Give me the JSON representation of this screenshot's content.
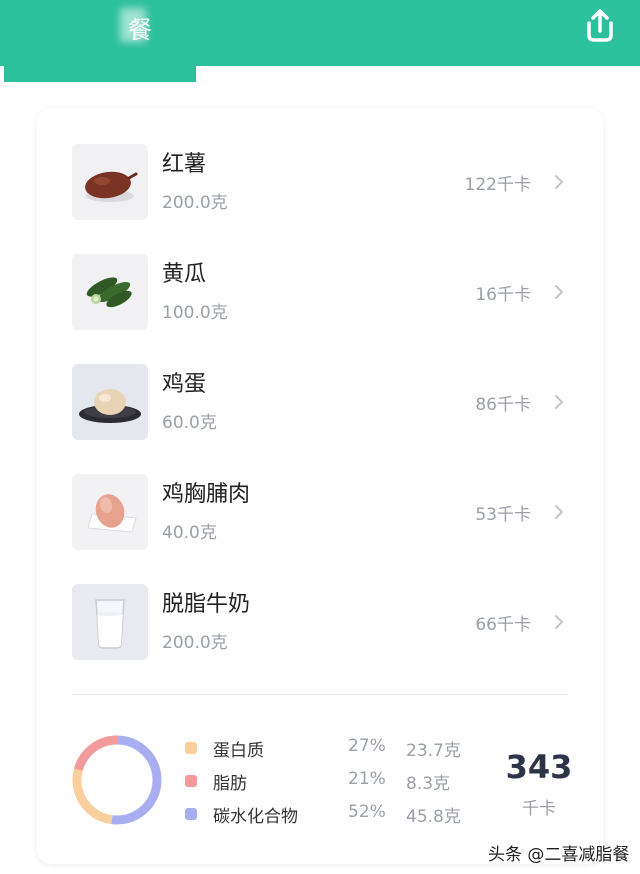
{
  "header": {
    "title": "餐",
    "accent_color": "#2cc09c",
    "share_icon": "share-upload-icon"
  },
  "foods": [
    {
      "name": "红薯",
      "amount": "200.0克",
      "kcal": "122千卡",
      "image": "sweet-potato-image"
    },
    {
      "name": "黄瓜",
      "amount": "100.0克",
      "kcal": "16千卡",
      "image": "cucumber-image"
    },
    {
      "name": "鸡蛋",
      "amount": "60.0克",
      "kcal": "86千卡",
      "image": "egg-image"
    },
    {
      "name": "鸡胸脯肉",
      "amount": "40.0克",
      "kcal": "53千卡",
      "image": "chicken-breast-image"
    },
    {
      "name": "脱脂牛奶",
      "amount": "200.0克",
      "kcal": "66千卡",
      "image": "skim-milk-image"
    }
  ],
  "macros": [
    {
      "name": "蛋白质",
      "percent": "27%",
      "grams": "23.7克",
      "color": "#f9cf9e",
      "fraction": 0.27
    },
    {
      "name": "脂肪",
      "percent": "21%",
      "grams": "8.3克",
      "color": "#f39a9a",
      "fraction": 0.21
    },
    {
      "name": "碳水化合物",
      "percent": "52%",
      "grams": "45.8克",
      "color": "#a9aef2",
      "fraction": 0.52
    }
  ],
  "total": {
    "kcal": "343",
    "unit": "千卡"
  },
  "watermark": "头条 @二喜减脂餐"
}
